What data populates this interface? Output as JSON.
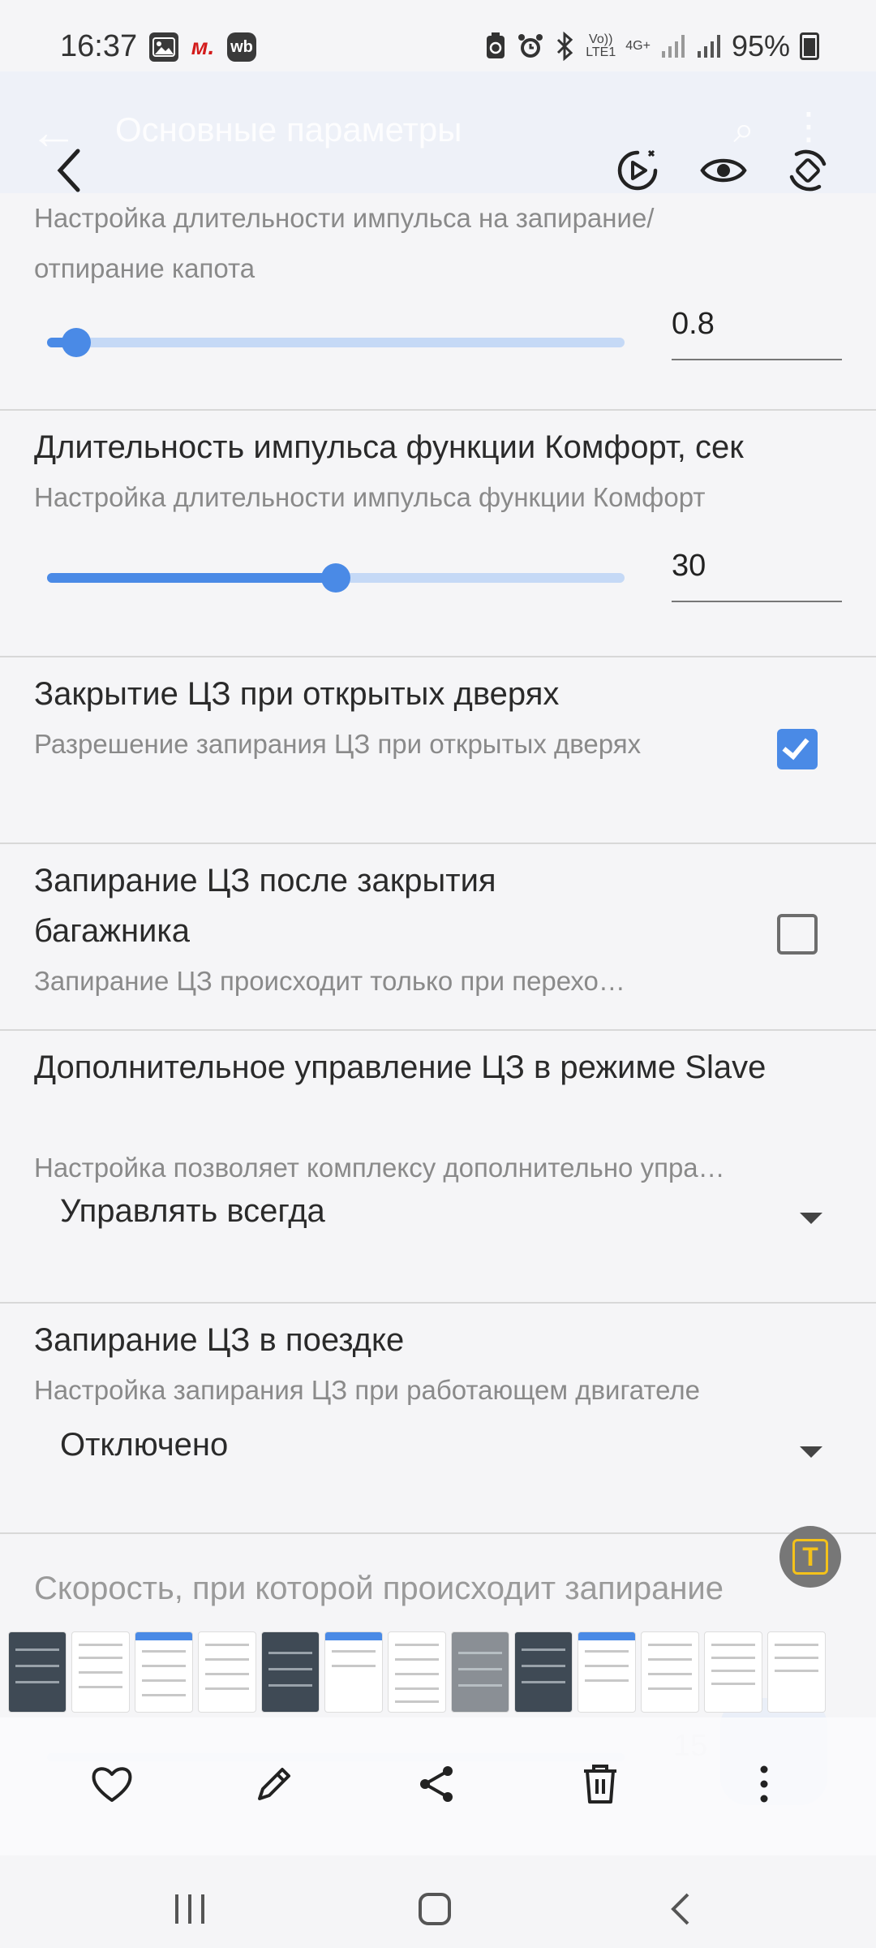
{
  "status_bar": {
    "time": "16:37",
    "left_icons": [
      "image-icon",
      "m-app-icon",
      "wb-app-icon"
    ],
    "network_label": "4G+",
    "volte_label": "Vo))\nLTE1",
    "battery": "95%"
  },
  "app_bar": {
    "title": "Основные параметры"
  },
  "settings": {
    "hood": {
      "desc": "Настройка длительности импульса на запирание/отпирание капота",
      "value": "0.8",
      "slider_level": 0.05
    },
    "comfort": {
      "title": "Длительность импульса функции Комфорт, сек",
      "desc": "Настройка длительности импульса функции Комфорт",
      "value": "30",
      "slider_level": 0.5
    },
    "doors_open": {
      "title": "Закрытие ЦЗ при открытых дверях",
      "desc": "Разрешение запирания ЦЗ при открытых дверях",
      "checked": true
    },
    "trunk": {
      "title": "Запирание ЦЗ после закрытия багажника",
      "desc": "Запирание ЦЗ происходит только при перехо…",
      "checked": false
    },
    "slave": {
      "title": "Дополнительное управление ЦЗ в режиме Slave",
      "desc": "Настройка позволяет комплексу дополнительно упра…",
      "selected": "Управлять всегда"
    },
    "driving": {
      "title": "Запирание ЦЗ в поездке",
      "desc": "Настройка запирания ЦЗ при работающем двигателе",
      "selected": "Отключено"
    },
    "speed": {
      "title": "Скорость, при которой происходит запирание",
      "value": "15"
    }
  },
  "ocr_button": {
    "label": "T"
  },
  "colors": {
    "accent": "#4a8ae6",
    "track": "#c5d9f6",
    "ocr": "#f4c21a"
  }
}
